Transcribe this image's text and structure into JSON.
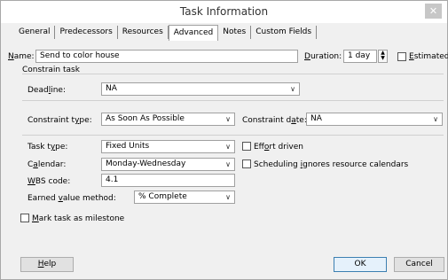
{
  "window": {
    "title": "Task Information",
    "close_glyph": "✕"
  },
  "tabs": [
    "General",
    "Predecessors",
    "Resources",
    "Advanced",
    "Notes",
    "Custom Fields"
  ],
  "active_tab": "Advanced",
  "name": {
    "label_u": "N",
    "label_rest": "ame:",
    "value": "Send to color house"
  },
  "duration": {
    "label_u": "D",
    "label_rest": "uration:",
    "value": "1 day"
  },
  "estimated": {
    "label_u": "E",
    "label_rest": "stimated",
    "checked": false
  },
  "constrain_task": {
    "heading": "Constrain task",
    "deadline": {
      "label_pre": "Dead",
      "label_u": "l",
      "label_rest": "ine:",
      "value": "NA"
    },
    "constraint_type": {
      "label_pre": "Constraint t",
      "label_u": "y",
      "label_rest": "pe:",
      "value": "As Soon As Possible"
    },
    "constraint_date": {
      "label_pre": "Constraint d",
      "label_u": "a",
      "label_rest": "te:",
      "value": "NA"
    }
  },
  "task_type": {
    "label_pre": "Task t",
    "label_u": "y",
    "label_rest": "pe:",
    "value": "Fixed Units"
  },
  "calendar": {
    "label_pre": "C",
    "label_u": "a",
    "label_rest": "lendar:",
    "value": "Monday-Wednesday"
  },
  "wbs": {
    "label_u": "W",
    "label_rest": "BS code:",
    "value": "4.1"
  },
  "earned_value": {
    "label_pre": "Earned ",
    "label_u": "v",
    "label_rest": "alue method:",
    "value": "% Complete"
  },
  "effort_driven": {
    "label_pre": "Eff",
    "label_u": "o",
    "label_rest": "rt driven",
    "checked": false
  },
  "scheduling_ignores": {
    "label_pre": "Scheduling ",
    "label_u": "i",
    "label_rest": "gnores resource calendars",
    "checked": false
  },
  "milestone": {
    "label_u": "M",
    "label_rest": "ark task as milestone",
    "checked": false
  },
  "buttons": {
    "help_u": "H",
    "help_rest": "elp",
    "ok": "OK",
    "cancel": "Cancel"
  }
}
